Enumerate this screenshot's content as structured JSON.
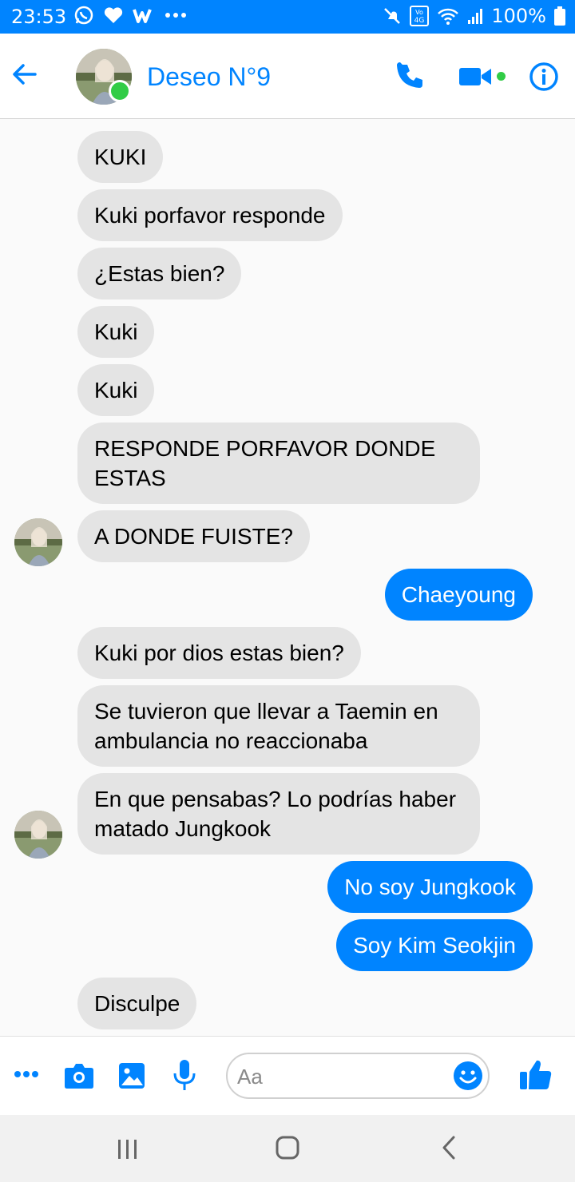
{
  "status_bar": {
    "time": "23:53",
    "left_icons": [
      "whatsapp-icon",
      "heart-icon",
      "wattpad-icon",
      "more-dots-icon"
    ],
    "right_icons": [
      "mute-icon",
      "volte-4g-icon",
      "wifi-icon",
      "signal-icon",
      "battery-icon"
    ],
    "battery": "100%"
  },
  "header": {
    "contact_name": "Deseo N°9",
    "online": true,
    "icons": [
      "back-arrow-icon",
      "phone-icon",
      "video-camera-icon",
      "info-icon"
    ]
  },
  "messages": [
    {
      "direction": "in",
      "text": "KUKI"
    },
    {
      "direction": "in",
      "text": "Kuki porfavor responde"
    },
    {
      "direction": "in",
      "text": "¿Estas bien?"
    },
    {
      "direction": "in",
      "text": "Kuki"
    },
    {
      "direction": "in",
      "text": "Kuki"
    },
    {
      "direction": "in",
      "text": "RESPONDE PORFAVOR DONDE ESTAS"
    },
    {
      "direction": "in",
      "text": "A DONDE FUISTE?"
    },
    {
      "direction": "out",
      "text": "Chaeyoung"
    },
    {
      "direction": "in",
      "text": "Kuki por dios estas bien?"
    },
    {
      "direction": "in",
      "text": "Se tuvieron que llevar a Taemin en ambulancia no reaccionaba"
    },
    {
      "direction": "in",
      "text": "En que pensabas? Lo podrías haber matado Jungkook"
    },
    {
      "direction": "out",
      "text": "No soy Jungkook"
    },
    {
      "direction": "out",
      "text": "Soy Kim Seokjin"
    },
    {
      "direction": "in",
      "text": "Disculpe"
    }
  ],
  "composer": {
    "placeholder": "Aa",
    "icons": [
      "more-dots-icon",
      "camera-icon",
      "gallery-icon",
      "microphone-icon",
      "emoji-icon",
      "thumbs-up-icon"
    ]
  },
  "colors": {
    "accent": "#0084ff",
    "incoming_bubble": "#e4e4e4",
    "online_green": "#31cc46"
  }
}
